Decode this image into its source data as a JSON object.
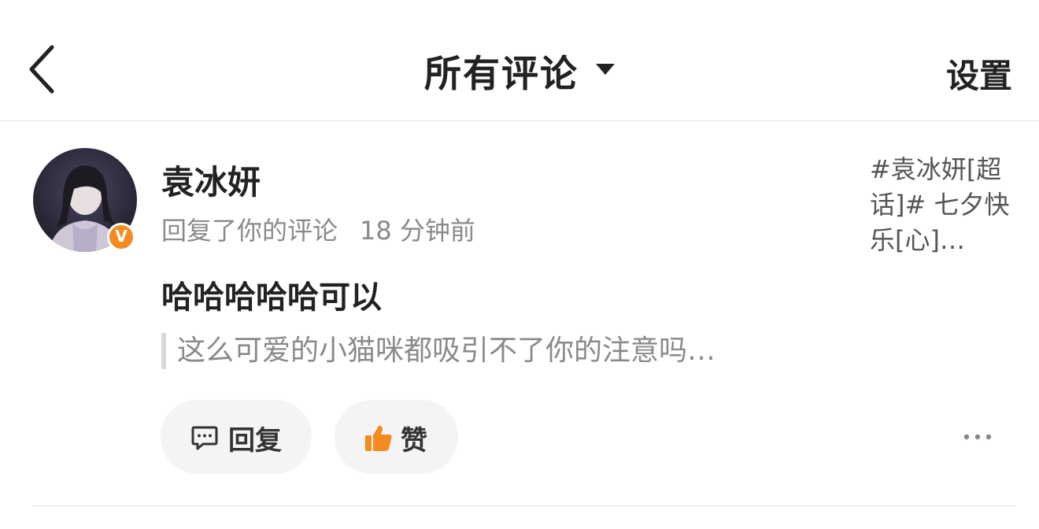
{
  "header": {
    "title": "所有评论",
    "settings_label": "设置"
  },
  "comment": {
    "username": "袁冰妍",
    "verified_badge": "V",
    "action_text": "回复了你的评论",
    "time": "18 分钟前",
    "post_preview": "#袁冰妍[超话]#  七夕快乐[心]…",
    "body": "哈哈哈哈哈可以",
    "quoted": "这么可爱的小猫咪都吸引不了你的注意吗…",
    "reply_label": "回复",
    "like_label": "赞"
  },
  "icons": {
    "back": "chevron-left-icon",
    "caret": "caret-down-icon",
    "reply": "comment-bubble-icon",
    "like": "thumbs-up-icon",
    "more": "more-horizontal-icon"
  },
  "colors": {
    "accent_orange": "#f58a20",
    "text_primary": "#222222",
    "text_secondary": "#8a8a8a",
    "button_bg": "#f4f4f4"
  }
}
